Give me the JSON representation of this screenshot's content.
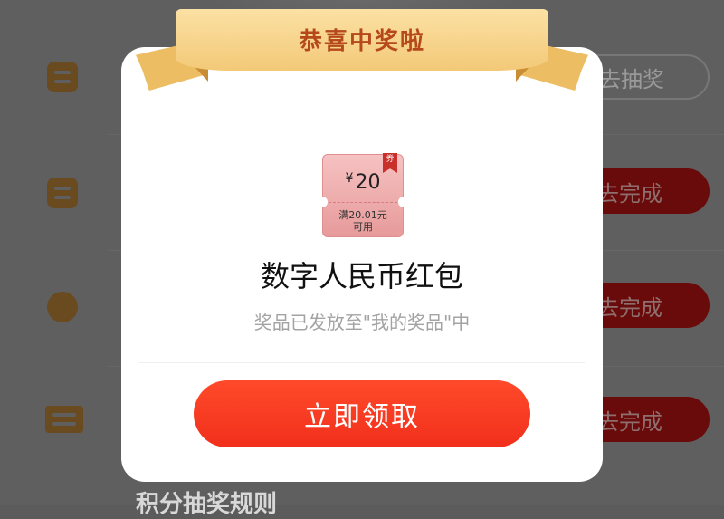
{
  "background": {
    "rows": [
      {
        "button_label": "去抽奖",
        "button_style": "outline"
      },
      {
        "button_label": "去完成",
        "button_style": "filled"
      },
      {
        "button_label": "去完成",
        "button_style": "filled"
      },
      {
        "button_label": "去完成",
        "button_style": "filled"
      }
    ],
    "bottom_partial_text": "积分抽奖规则"
  },
  "modal": {
    "banner_title": "恭喜中奖啦",
    "coupon": {
      "currency_symbol": "¥",
      "amount": "20",
      "condition_line1": "满20.01元",
      "condition_line2": "可用",
      "tag": "券"
    },
    "prize_name": "数字人民币红包",
    "prize_note": "奖品已发放至\"我的奖品\"中",
    "claim_button_label": "立即领取"
  },
  "colors": {
    "claim_button": "#f12f1c",
    "banner": "#f3c978",
    "banner_text": "#b5491c",
    "coupon": "#e79a9a"
  }
}
